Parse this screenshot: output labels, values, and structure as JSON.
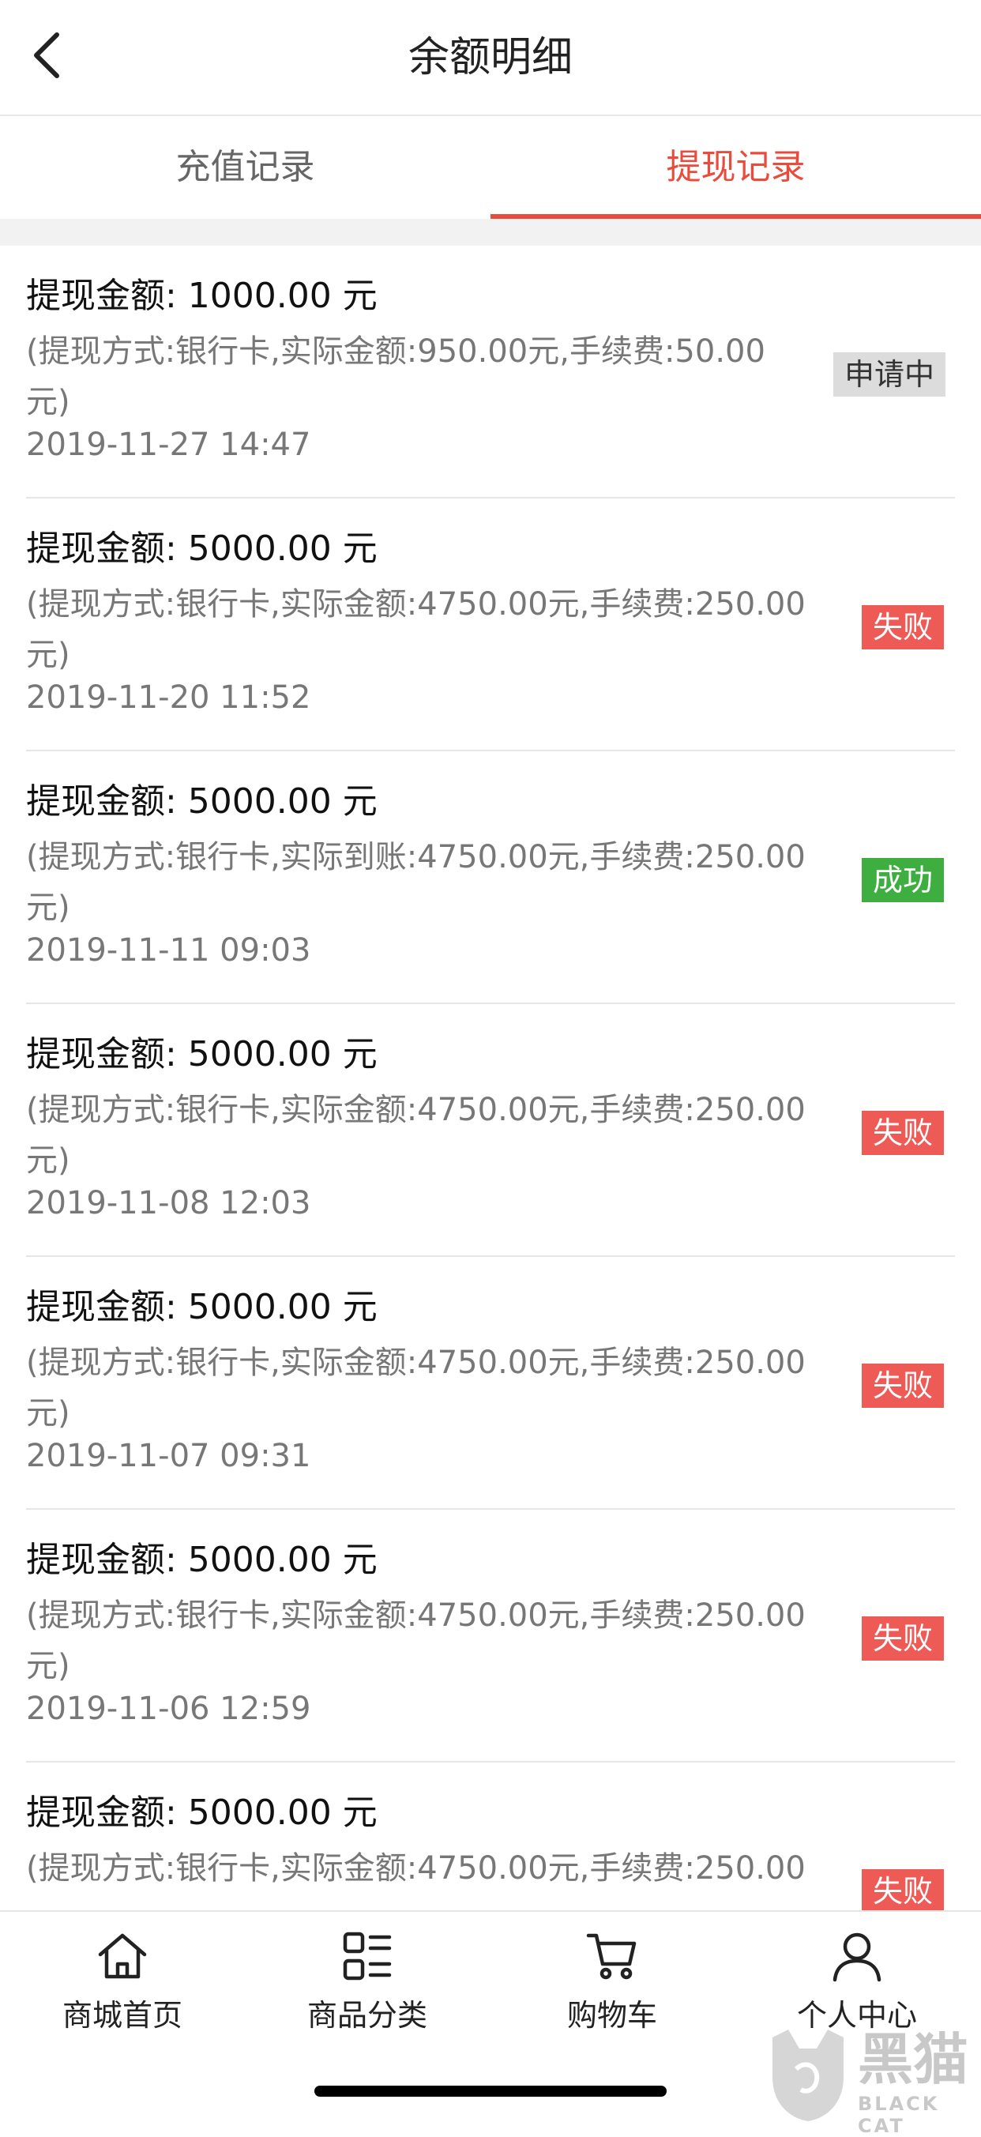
{
  "header": {
    "title": "余额明细"
  },
  "tabs": [
    {
      "label": "充值记录",
      "active": false
    },
    {
      "label": "提现记录",
      "active": true
    }
  ],
  "records": [
    {
      "amount": "提现金额: 1000.00 元",
      "detail": "(提现方式:银行卡,实际金额:950.00元,手续费:50.00元)",
      "date": "2019-11-27 14:47",
      "status": "申请中",
      "status_type": "pending"
    },
    {
      "amount": "提现金额: 5000.00 元",
      "detail": "(提现方式:银行卡,实际金额:4750.00元,手续费:250.00元)",
      "date": "2019-11-20 11:52",
      "status": "失败",
      "status_type": "failed"
    },
    {
      "amount": "提现金额: 5000.00 元",
      "detail": "(提现方式:银行卡,实际到账:4750.00元,手续费:250.00元)",
      "date": "2019-11-11 09:03",
      "status": "成功",
      "status_type": "success"
    },
    {
      "amount": "提现金额: 5000.00 元",
      "detail": "(提现方式:银行卡,实际金额:4750.00元,手续费:250.00元)",
      "date": "2019-11-08 12:03",
      "status": "失败",
      "status_type": "failed"
    },
    {
      "amount": "提现金额: 5000.00 元",
      "detail": "(提现方式:银行卡,实际金额:4750.00元,手续费:250.00元)",
      "date": "2019-11-07 09:31",
      "status": "失败",
      "status_type": "failed"
    },
    {
      "amount": "提现金额: 5000.00 元",
      "detail": "(提现方式:银行卡,实际金额:4750.00元,手续费:250.00元)",
      "date": "2019-11-06 12:59",
      "status": "失败",
      "status_type": "failed"
    },
    {
      "amount": "提现金额: 5000.00 元",
      "detail": "(提现方式:银行卡,实际金额:4750.00元,手续费:250.00",
      "date": "",
      "status": "失败",
      "status_type": "failed"
    }
  ],
  "tabbar": [
    {
      "label": "商城首页",
      "icon": "home-icon"
    },
    {
      "label": "商品分类",
      "icon": "category-icon"
    },
    {
      "label": "购物车",
      "icon": "cart-icon"
    },
    {
      "label": "个人中心",
      "icon": "user-icon"
    }
  ],
  "watermark": {
    "text": "黑猫",
    "sub": "BLACK CAT"
  },
  "colors": {
    "accent": "#e94b3c",
    "failed": "#ee5a55",
    "success": "#3dae3f",
    "pending": "#dcdcdc"
  }
}
